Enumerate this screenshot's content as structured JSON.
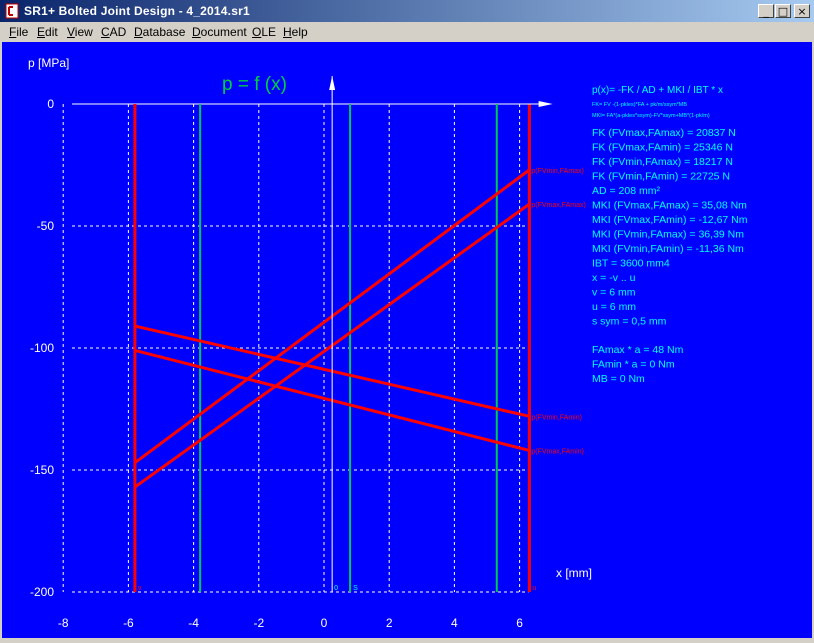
{
  "window": {
    "title": "SR1+   Bolted Joint Design  -  4_2014.sr1",
    "minimize_glyph": "_",
    "maximize_glyph": "□",
    "close_glyph": "×",
    "icon": "sr1-app-icon"
  },
  "menu": {
    "items": [
      {
        "label": "File",
        "underline": "F",
        "rest": "ile"
      },
      {
        "label": "Edit",
        "underline": "E",
        "rest": "dit"
      },
      {
        "label": "View",
        "underline": "V",
        "rest": "iew"
      },
      {
        "label": "CAD",
        "underline": "C",
        "rest": "AD"
      },
      {
        "label": "Database",
        "underline": "D",
        "rest": "atabase"
      },
      {
        "label": "Document",
        "underline": "D",
        "rest": "ocument"
      },
      {
        "label": "OLE",
        "underline": "O",
        "rest": "LE"
      },
      {
        "label": "Help",
        "underline": "H",
        "rest": "elp"
      }
    ]
  },
  "colors": {
    "background": "#0000ff",
    "series": "#ff0000",
    "boundary": "#ff0000",
    "green": "#00c853",
    "title": "#00d040",
    "info_text": "#00ffff",
    "axis_text": "#ffffff"
  },
  "chart_data": {
    "type": "line",
    "title": "p = f (x)",
    "xlabel": "x [mm]",
    "ylabel": "p [MPa]",
    "xlim": [
      -8,
      6.4
    ],
    "ylim": [
      -200,
      0
    ],
    "x_ticks": [
      -8,
      -6,
      -4,
      -2,
      0,
      2,
      4,
      6
    ],
    "y_ticks": [
      0,
      -50,
      -100,
      -150,
      -200
    ],
    "grid": true,
    "boundaries": [
      {
        "x": -5.8,
        "label": "v"
      },
      {
        "x": 6.3,
        "label": "u"
      }
    ],
    "green_lines": [
      {
        "x": -3.8,
        "label": ""
      },
      {
        "x": 0.8,
        "label": "S"
      },
      {
        "x": 5.3,
        "label": ""
      }
    ],
    "origin_marker": {
      "x": 0.25,
      "label": "0"
    },
    "series": [
      {
        "name": "p(FVmin,FAmax)",
        "x": [
          -5.8,
          6.3
        ],
        "y": [
          -147,
          -27
        ]
      },
      {
        "name": "p(FVmax,FAmax)",
        "x": [
          -5.8,
          6.3
        ],
        "y": [
          -157,
          -41
        ]
      },
      {
        "name": "p(FVmin,FAmin)",
        "x": [
          -5.8,
          6.3
        ],
        "y": [
          -91,
          -128
        ]
      },
      {
        "name": "p(FVmax,FAmin)",
        "x": [
          -5.8,
          6.3
        ],
        "y": [
          -101,
          -142
        ]
      }
    ]
  },
  "info_panel": {
    "formula": "p(x)= -FK / AD + MKI / IBT * x",
    "formula_sub1": "FK= FV -(1-pkles)*FA + pk/m/ssym*MB",
    "formula_sub2": "MKI= FA*(a-pkles*ssym)-FV*ssym+MB*(1-pk/m)",
    "lines": [
      "FK (FVmax,FAmax) = 20837 N",
      "FK (FVmax,FAmin) = 25346 N",
      "FK (FVmin,FAmax) = 18217 N",
      "FK (FVmin,FAmin) = 22725 N",
      "AD = 208 mm²",
      "MKI (FVmax,FAmax) = 35,08 Nm",
      "MKI (FVmax,FAmin) = -12,67 Nm",
      "MKI (FVmin,FAmax) = 36,39 Nm",
      "MKI (FVmin,FAmin) = -11,36 Nm",
      "IBT = 3600 mm4",
      "x = -v .. u",
      "v = 6 mm",
      "u = 6 mm",
      "s sym = 0,5 mm"
    ],
    "lines2": [
      "FAmax * a = 48 Nm",
      "FAmin * a = 0 Nm",
      "MB  =  0 Nm"
    ]
  }
}
